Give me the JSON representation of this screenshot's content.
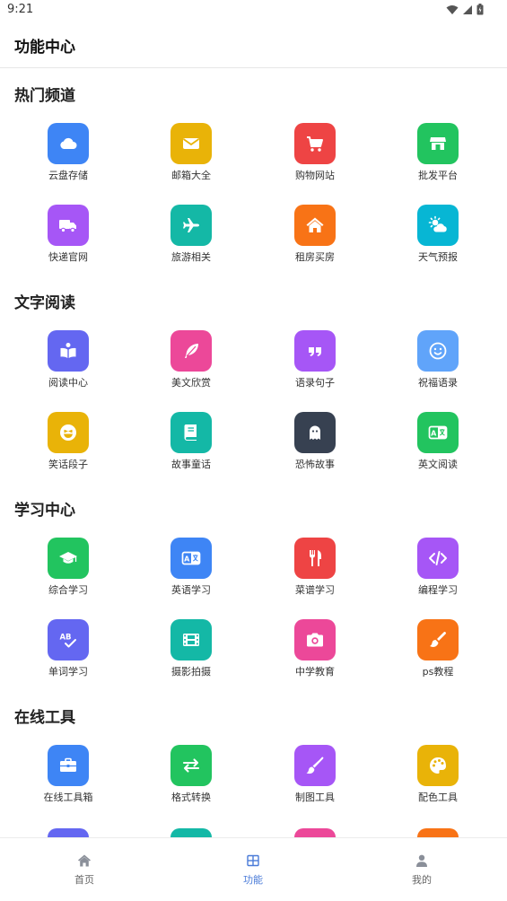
{
  "status": {
    "time": "9:21"
  },
  "header": {
    "title": "功能中心"
  },
  "sections": [
    {
      "title": "热门频道",
      "items": [
        {
          "label": "云盘存储",
          "icon": "cloud-icon",
          "color": "#3e85f5"
        },
        {
          "label": "邮箱大全",
          "icon": "envelope-icon",
          "color": "#e9b308"
        },
        {
          "label": "购物网站",
          "icon": "cart-icon",
          "color": "#ee4444"
        },
        {
          "label": "批发平台",
          "icon": "store-icon",
          "color": "#22c45f"
        },
        {
          "label": "快递官网",
          "icon": "truck-icon",
          "color": "#a656f6"
        },
        {
          "label": "旅游相关",
          "icon": "plane-icon",
          "color": "#14b8a6"
        },
        {
          "label": "租房买房",
          "icon": "house-icon",
          "color": "#f87316"
        },
        {
          "label": "天气预报",
          "icon": "weather-icon",
          "color": "#07b6d4"
        }
      ]
    },
    {
      "title": "文字阅读",
      "items": [
        {
          "label": "阅读中心",
          "icon": "book-reader-icon",
          "color": "#6467f1"
        },
        {
          "label": "美文欣赏",
          "icon": "feather-icon",
          "color": "#ec4899"
        },
        {
          "label": "语录句子",
          "icon": "quote-icon",
          "color": "#a656f6"
        },
        {
          "label": "祝福语录",
          "icon": "smile-icon",
          "color": "#60a4fa"
        },
        {
          "label": "笑话段子",
          "icon": "laugh-icon",
          "color": "#e9b308"
        },
        {
          "label": "故事童话",
          "icon": "book-icon",
          "color": "#14b8a6"
        },
        {
          "label": "恐怖故事",
          "icon": "ghost-icon",
          "color": "#374151"
        },
        {
          "label": "英文阅读",
          "icon": "translate-icon",
          "color": "#22c45f"
        }
      ]
    },
    {
      "title": "学习中心",
      "items": [
        {
          "label": "综合学习",
          "icon": "graduation-cap-icon",
          "color": "#22c45f"
        },
        {
          "label": "英语学习",
          "icon": "language-icon",
          "color": "#3e85f5"
        },
        {
          "label": "菜谱学习",
          "icon": "utensils-icon",
          "color": "#ee4444"
        },
        {
          "label": "编程学习",
          "icon": "code-icon",
          "color": "#a656f6"
        },
        {
          "label": "单词学习",
          "icon": "spell-check-icon",
          "color": "#6467f1"
        },
        {
          "label": "摄影拍摄",
          "icon": "film-icon",
          "color": "#14b8a6"
        },
        {
          "label": "中学教育",
          "icon": "camera-icon",
          "color": "#ec4899"
        },
        {
          "label": "ps教程",
          "icon": "brush-icon",
          "color": "#f87316"
        }
      ]
    },
    {
      "title": "在线工具",
      "items": [
        {
          "label": "在线工具箱",
          "icon": "toolbox-icon",
          "color": "#3e85f5"
        },
        {
          "label": "格式转换",
          "icon": "exchange-icon",
          "color": "#22c45f"
        },
        {
          "label": "制图工具",
          "icon": "paintbrush-icon",
          "color": "#a656f6"
        },
        {
          "label": "配色工具",
          "icon": "palette-icon",
          "color": "#e9b308"
        }
      ]
    }
  ],
  "peek_colors": [
    "#6467f1",
    "#14b8a6",
    "#ec4899",
    "#f87316"
  ],
  "nav": [
    {
      "label": "首页",
      "icon": "home-icon",
      "active": false
    },
    {
      "label": "功能",
      "icon": "grid-icon",
      "active": true
    },
    {
      "label": "我的",
      "icon": "user-icon",
      "active": false
    }
  ],
  "colors": {
    "accent": "#4a7bd8",
    "nav_inactive": "#8a8f99"
  }
}
